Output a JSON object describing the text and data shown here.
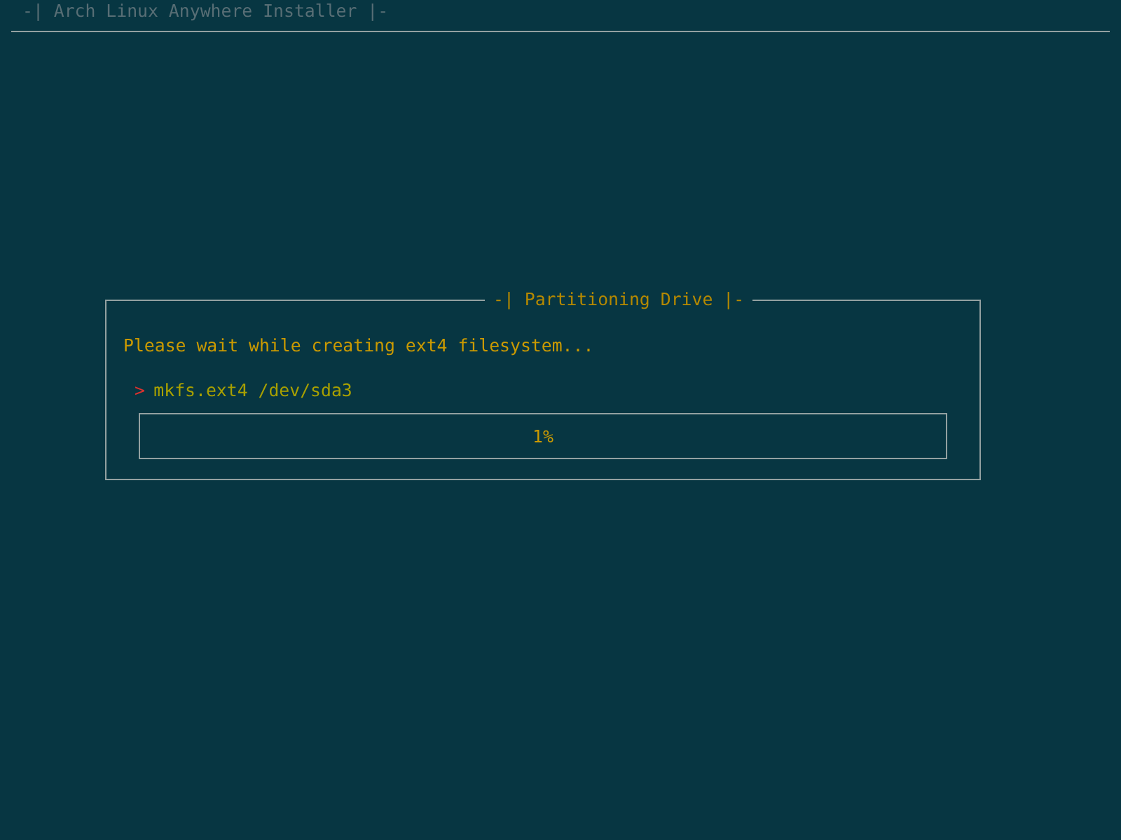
{
  "window": {
    "title": "-| Arch Linux Anywhere Installer |-"
  },
  "dialog": {
    "title": "-| Partitioning Drive |-",
    "message": "Please wait while creating ext4 filesystem...",
    "prompt": ">",
    "command": "mkfs.ext4 /dev/sda3",
    "progress": {
      "level": 0.01,
      "reading": "1%"
    }
  }
}
